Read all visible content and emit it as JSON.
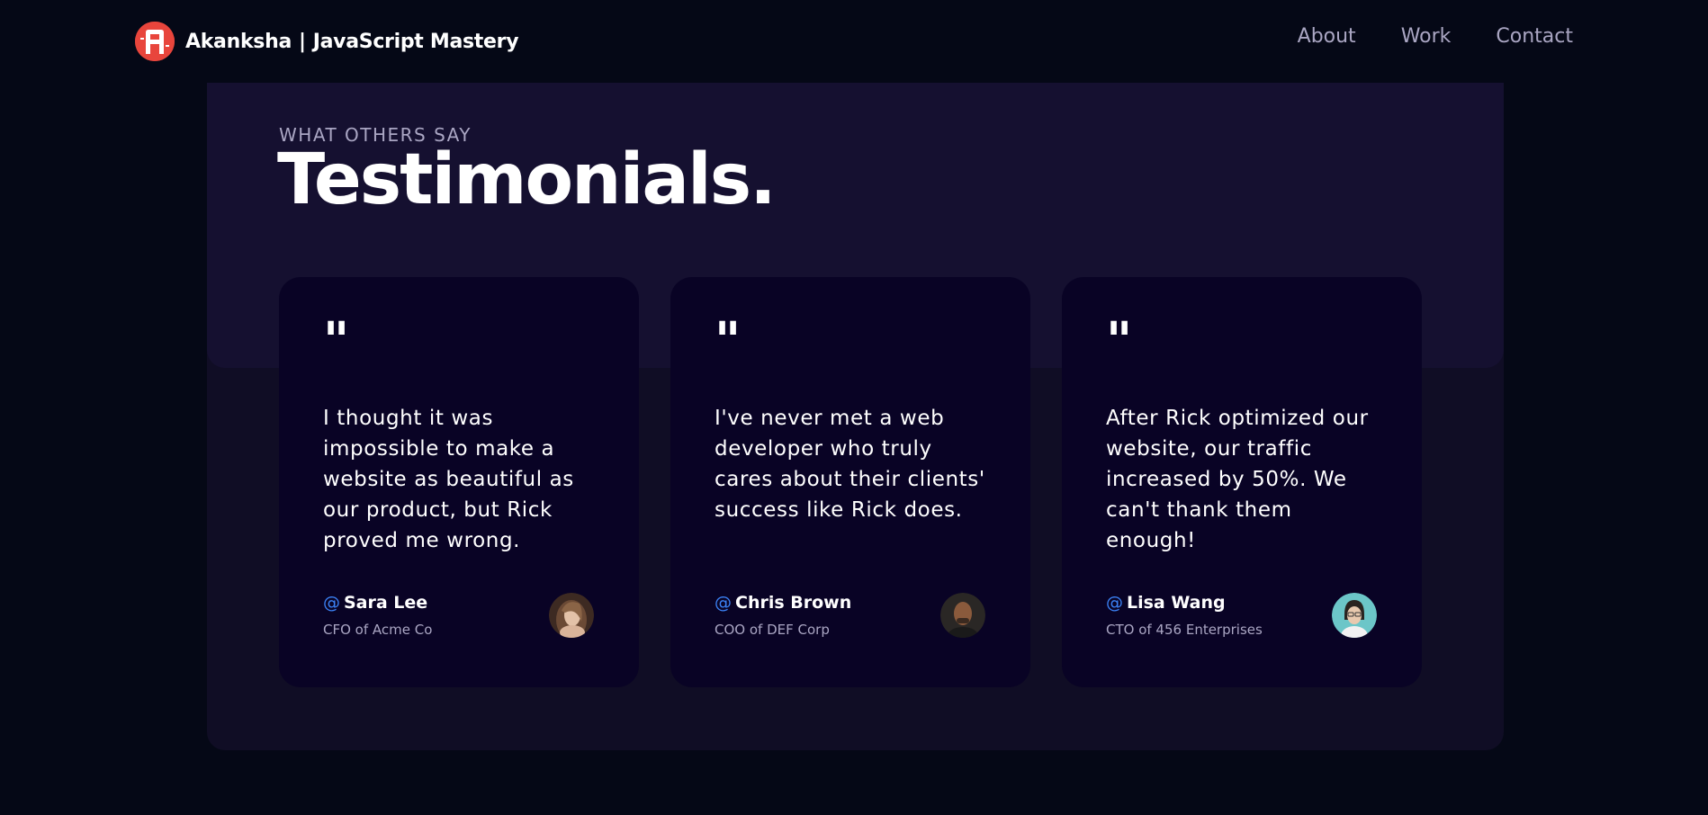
{
  "navbar": {
    "brand_first": "Akanksha",
    "brand_sep": "|",
    "brand_second": "JavaScript Mastery",
    "logo_icon": "akanksha-logo-icon",
    "links": [
      {
        "label": "About"
      },
      {
        "label": "Work"
      },
      {
        "label": "Contact"
      }
    ]
  },
  "section": {
    "sub_heading": "What others say",
    "heading": "Testimonials."
  },
  "testimonials": [
    {
      "quote_mark": "\"",
      "text": "I thought it was impossible to make a website as beautiful as our product, but Rick proved me wrong.",
      "at": "@",
      "name": "Sara Lee",
      "role": "CFO of Acme Co",
      "avatar_icon": "sara-lee-avatar"
    },
    {
      "quote_mark": "\"",
      "text": "I've never met a web developer who truly cares about their clients' success like Rick does.",
      "at": "@",
      "name": "Chris Brown",
      "role": "COO of DEF Corp",
      "avatar_icon": "chris-brown-avatar"
    },
    {
      "quote_mark": "\"",
      "text": "After Rick optimized our website, our traffic increased by 50%. We can't thank them enough!",
      "at": "@",
      "name": "Lisa Wang",
      "role": "CTO of 456 Enterprises",
      "avatar_icon": "lisa-wang-avatar"
    }
  ],
  "colors": {
    "background": "#050816",
    "section": "#100d25",
    "section_top": "#151030",
    "card": "#090325",
    "secondary_text": "#aaa6c3",
    "accent_blue": "#3b82f6",
    "logo_red": "#e8453c"
  }
}
